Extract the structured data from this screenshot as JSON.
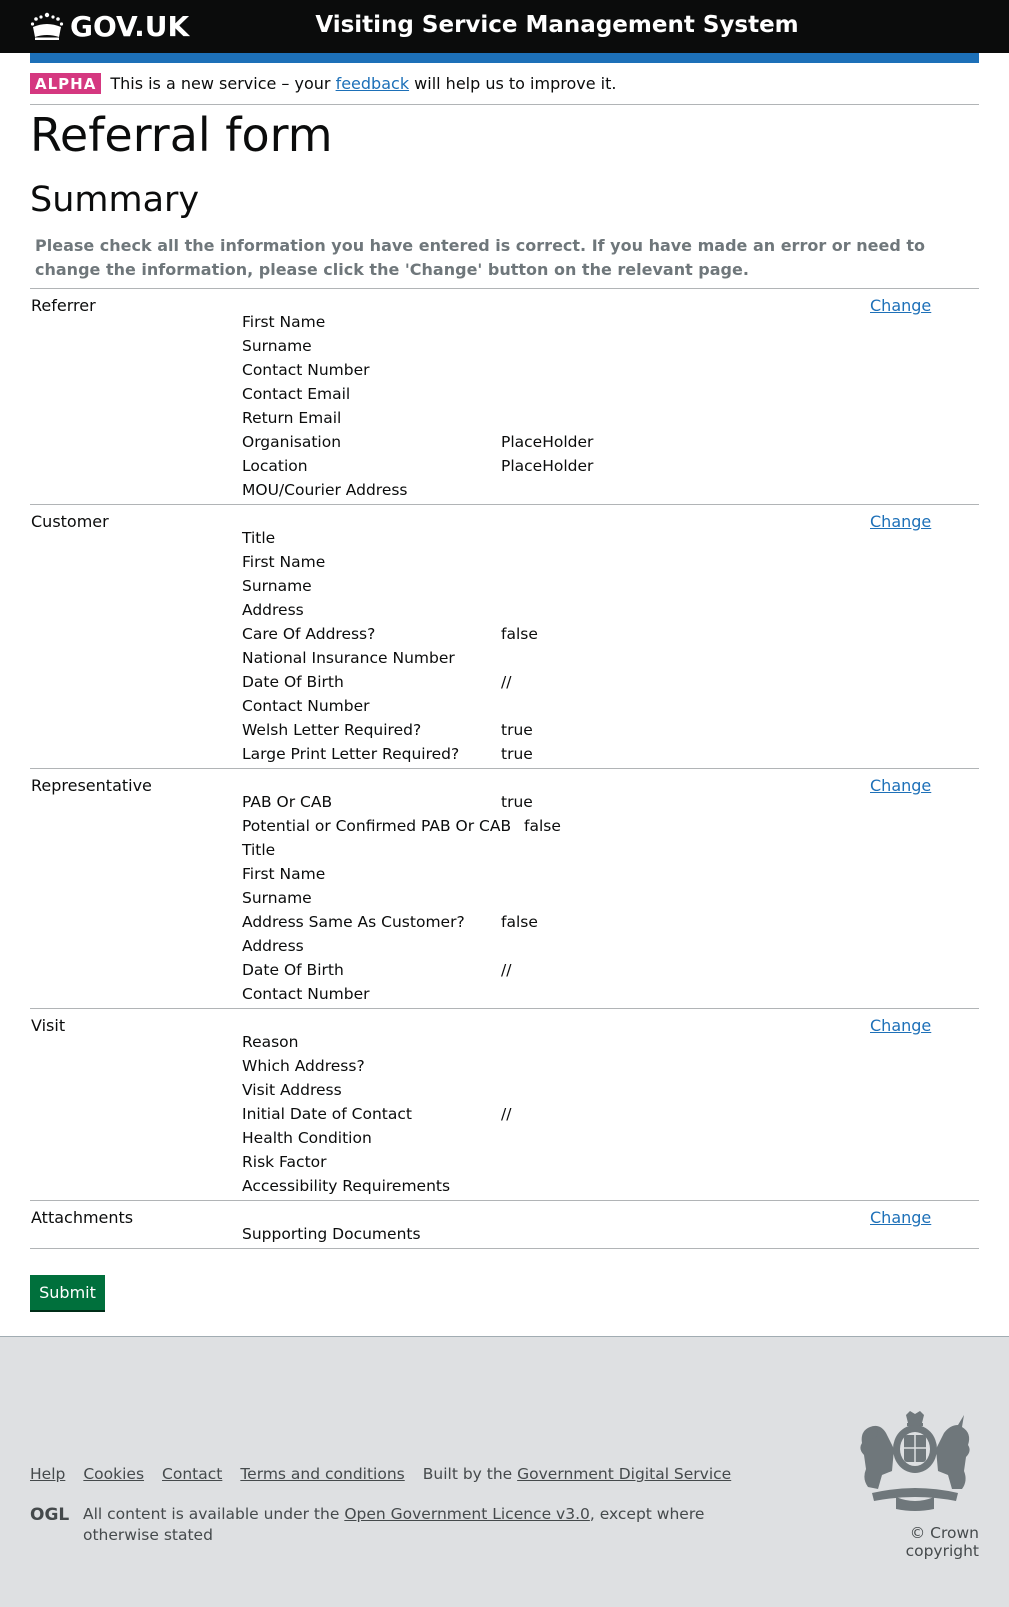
{
  "header": {
    "logo_text": "GOV.UK",
    "service_name": "Visiting Service Management System"
  },
  "phase_banner": {
    "tag": "ALPHA",
    "text_before": "This is a new service – your ",
    "link": "feedback",
    "text_after": " will help us to improve it."
  },
  "page_title": "Referral form",
  "subtitle": "Summary",
  "lead_text": "Please check all the information you have entered is correct. If you have made an error or need to change the information, please click the 'Change' button on the relevant page.",
  "sections": [
    {
      "title": "Referrer",
      "change_label": "Change",
      "rows": [
        {
          "key": "First Name",
          "value": ""
        },
        {
          "key": "Surname",
          "value": ""
        },
        {
          "key": "Contact Number",
          "value": ""
        },
        {
          "key": "Contact Email",
          "value": ""
        },
        {
          "key": "Return Email",
          "value": ""
        },
        {
          "key": "Organisation",
          "value": "PlaceHolder"
        },
        {
          "key": "Location",
          "value": "PlaceHolder"
        },
        {
          "key": "MOU/Courier Address",
          "value": ""
        }
      ]
    },
    {
      "title": "Customer",
      "change_label": "Change",
      "rows": [
        {
          "key": "Title",
          "value": ""
        },
        {
          "key": "First Name",
          "value": ""
        },
        {
          "key": "Surname",
          "value": ""
        },
        {
          "key": "Address",
          "value": ""
        },
        {
          "key": "Care Of Address?",
          "value": "false"
        },
        {
          "key": "National Insurance Number",
          "value": ""
        },
        {
          "key": "Date Of Birth",
          "value": "//"
        },
        {
          "key": "Contact Number",
          "value": ""
        },
        {
          "key": "Welsh Letter Required?",
          "value": "true"
        },
        {
          "key": "Large Print Letter Required?",
          "value": "true"
        }
      ]
    },
    {
      "title": "Representative",
      "change_label": "Change",
      "rows": [
        {
          "key": "PAB Or CAB",
          "value": "true"
        },
        {
          "key": "Potential or Confirmed PAB Or CAB",
          "value": "false"
        },
        {
          "key": "Title",
          "value": ""
        },
        {
          "key": "First Name",
          "value": ""
        },
        {
          "key": "Surname",
          "value": ""
        },
        {
          "key": "Address Same As Customer?",
          "value": "false"
        },
        {
          "key": "Address",
          "value": ""
        },
        {
          "key": "Date Of Birth",
          "value": "//"
        },
        {
          "key": "Contact Number",
          "value": ""
        }
      ]
    },
    {
      "title": "Visit",
      "change_label": "Change",
      "rows": [
        {
          "key": "Reason",
          "value": ""
        },
        {
          "key": "Which Address?",
          "value": ""
        },
        {
          "key": "Visit Address",
          "value": ""
        },
        {
          "key": "Initial Date of Contact",
          "value": "//"
        },
        {
          "key": "Health Condition",
          "value": ""
        },
        {
          "key": "Risk Factor",
          "value": ""
        },
        {
          "key": "Accessibility Requirements",
          "value": ""
        }
      ]
    },
    {
      "title": "Attachments",
      "change_label": "Change",
      "rows": [
        {
          "key": "Supporting Documents",
          "value": ""
        }
      ]
    }
  ],
  "submit_label": "Submit",
  "footer": {
    "links": [
      "Help",
      "Cookies",
      "Contact",
      "Terms and conditions"
    ],
    "built_by_prefix": "Built by the ",
    "built_by_link": "Government Digital Service",
    "licence_prefix": "All content is available under the ",
    "licence_link": "Open Government Licence v3.0",
    "licence_suffix": ", except where otherwise stated",
    "copyright": "© Crown copyright",
    "ogl_logo_text": "OGL"
  },
  "colors": {
    "header_bg": "#0b0c0c",
    "blue_bar": "#1d70b8",
    "alpha_tag": "#d53880",
    "link": "#1d70b8",
    "submit": "#00703c",
    "footer_bg": "#dee0e2"
  }
}
